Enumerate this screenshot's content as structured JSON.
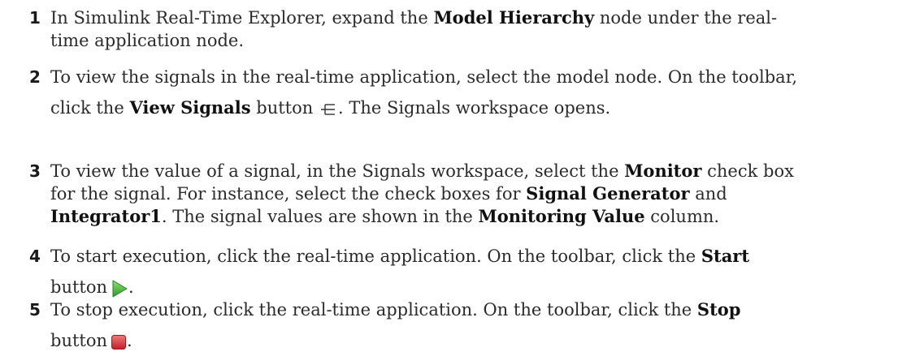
{
  "steps": [
    {
      "number": "1",
      "parts": [
        "In Simulink Real-Time Explorer, expand the ",
        "Model Hierarchy",
        " node under the real-",
        "time application node."
      ]
    },
    {
      "number": "2",
      "parts": [
        "To view the signals in the real-time application, select the model node. On the toolbar,",
        "click the ",
        "View Signals",
        " button ",
        ". The Signals workspace opens."
      ],
      "icon": "view-signals-icon"
    },
    {
      "number": "3",
      "parts": [
        "To view the value of a signal, in the Signals workspace, select the ",
        "Monitor",
        " check box",
        "for the signal. For instance, select the check boxes for ",
        "Signal Generator",
        " and",
        "Integrator1",
        ". The signal values are shown in the ",
        "Monitoring Value",
        " column."
      ]
    },
    {
      "number": "4",
      "parts": [
        "To start execution, click the real-time application. On the toolbar, click the ",
        "Start",
        "button",
        "."
      ],
      "icon": "start-icon"
    },
    {
      "number": "5",
      "parts": [
        "To stop execution, click the real-time application. On the toolbar, click the ",
        "Stop",
        "button",
        "."
      ],
      "icon": "stop-icon"
    }
  ],
  "colors": {
    "start_green": "#3cb043",
    "stop_red": "#d9363e"
  }
}
